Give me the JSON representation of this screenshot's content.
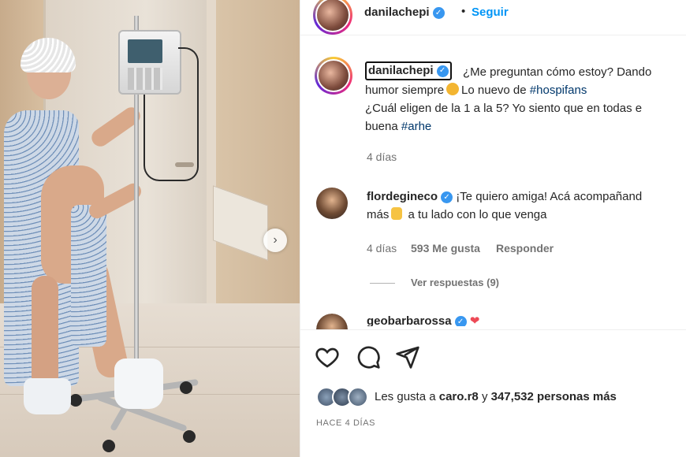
{
  "post": {
    "author": "danilachepi",
    "follow_label": "Seguir",
    "separator": "•",
    "verified_glyph": "✓",
    "caption": {
      "line1": "¿Me preguntan cómo estoy? Dando",
      "line2_a": "humor siempre",
      "line2_b": "Lo nuevo de",
      "hashtag1": "#hospifans",
      "line3": "¿Cuál eligen de la 1 a la 5? Yo siento que en todas e",
      "line4_a": "buena",
      "hashtag2": "#arhe",
      "emoji": "rofl-emoji"
    },
    "caption_time": "4 días"
  },
  "comments": [
    {
      "user": "flordegineco",
      "text_line1": "¡Te quiero amiga! Acá acompañand",
      "text_line2_a": "más",
      "text_line2_b": "a tu lado con lo que venga",
      "emoji": "raised-hands-emoji",
      "time": "4 días",
      "likes": "593 Me gusta",
      "reply": "Responder",
      "view_replies": "Ver respuestas (9)"
    },
    {
      "user": "geobarbarossa",
      "emoji": "red-heart-emoji"
    }
  ],
  "actions": {
    "like": "heart-icon",
    "comment": "comment-icon",
    "share": "send-icon"
  },
  "likes": {
    "prefix": "Les gusta a",
    "user": "caro.r8",
    "joiner": "y",
    "count": "347,532 personas más"
  },
  "date": "HACE 4 DÍAS",
  "carousel": {
    "next_glyph": "›"
  },
  "colors": {
    "link_blue": "#0095f6",
    "hashtag": "#00376b",
    "verified": "#3897f0",
    "muted": "#737373",
    "heart": "#ed4956"
  }
}
